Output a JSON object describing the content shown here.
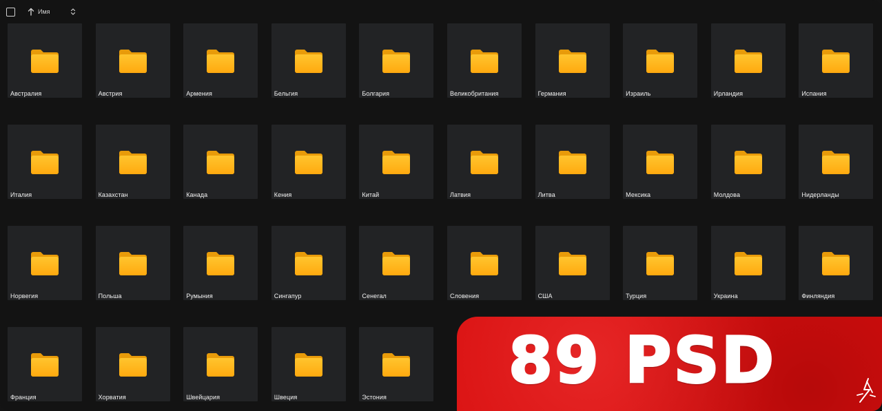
{
  "header": {
    "sort_label": "Имя"
  },
  "folders": [
    "Австралия",
    "Австрия",
    "Армения",
    "Бельгия",
    "Болгария",
    "Великобритания",
    "Германия",
    "Израиль",
    "Ирландия",
    "Испания",
    "Италия",
    "Казахстан",
    "Канада",
    "Кения",
    "Китай",
    "Латвия",
    "Литва",
    "Мексика",
    "Молдова",
    "Нидерланды",
    "Норвегия",
    "Польша",
    "Румыния",
    "Сингапур",
    "Сенегал",
    "Словения",
    "США",
    "Турция",
    "Украина",
    "Финляндия",
    "Франция",
    "Хорватия",
    "Швейцария",
    "Швеция",
    "Эстония"
  ],
  "banner": {
    "text": "89 PSD"
  },
  "colors": {
    "background": "#131313",
    "tile": "#222325",
    "folder": "#FFB81C",
    "banner": "#D80F0F"
  },
  "icons": {
    "folder": "folder-icon",
    "sort": "arrow-up-icon",
    "toggle": "chevron-up-down-icon",
    "logo": "brand-logo-icon"
  }
}
